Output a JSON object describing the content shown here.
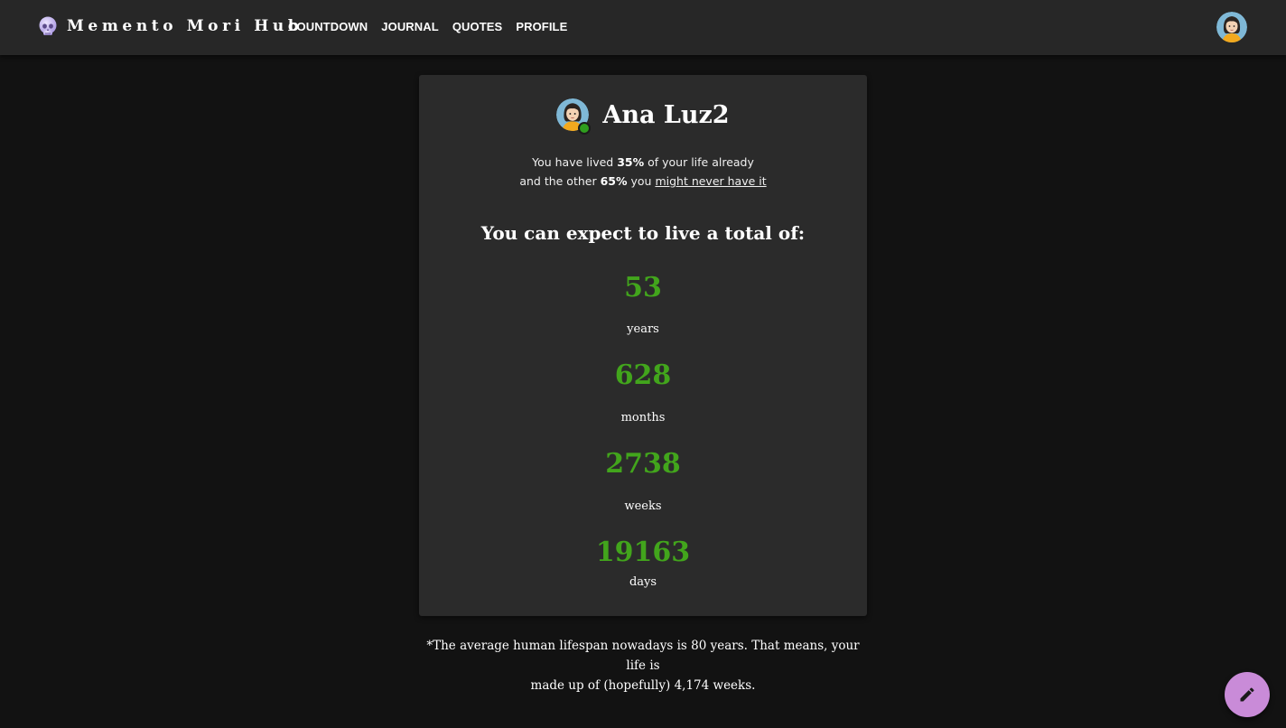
{
  "brand": {
    "name": "Memento Mori Hub",
    "icon": "skull-icon"
  },
  "nav": {
    "links": [
      "COUNTDOWN",
      "JOURNAL",
      "QUOTES",
      "PROFILE"
    ]
  },
  "profile": {
    "name": "Ana Luz2",
    "status": "online"
  },
  "lived": {
    "line1_prefix": "You have lived ",
    "lived_percent": "35%",
    "line1_suffix": " of your life already",
    "line2_prefix": "and the other ",
    "remaining_percent": "65%",
    "line2_middle": " you ",
    "line2_link": "might never have it"
  },
  "expectancy": {
    "heading": "You can expect to live a total of:",
    "stats": [
      {
        "value": "53",
        "label": "years"
      },
      {
        "value": "628",
        "label": "months"
      },
      {
        "value": "2738",
        "label": "weeks"
      },
      {
        "value": "19163",
        "label": "days"
      }
    ]
  },
  "footnote": {
    "line1": "*The average human lifespan nowadays is 80 years. That means, your life is",
    "line2": "made up of (hopefully) 4,174 weeks."
  },
  "fab": {
    "icon": "pencil-icon"
  },
  "colors": {
    "accent_green": "#42a51c",
    "fab_purple": "#c98bd8",
    "background": "#121212",
    "card": "#2b2b2b",
    "navbar": "#272727"
  }
}
